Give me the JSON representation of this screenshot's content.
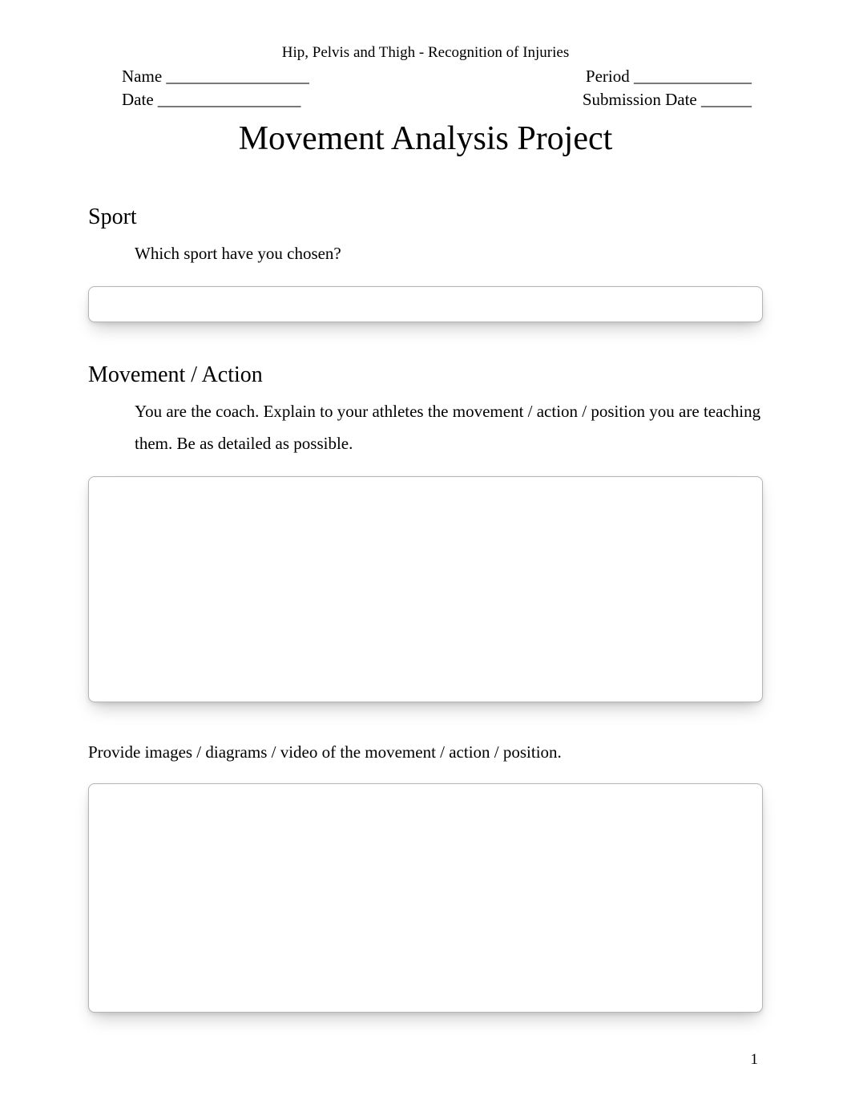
{
  "header": {
    "subject": "Hip, Pelvis and Thigh - Recognition of Injuries",
    "name_label": "Name  _________________",
    "period_label": "Period  ______________",
    "date_label": "Date    _________________",
    "submission_label": "Submission Date ______"
  },
  "title": "Movement Analysis Project",
  "sections": {
    "sport": {
      "heading": "Sport",
      "prompt": "Which sport have you chosen?"
    },
    "movement": {
      "heading": "Movement / Action",
      "prompt": "You are the coach. Explain to your athletes the movement / action / position you are teaching them. Be as detailed as possible."
    },
    "images_prompt": "Provide images / diagrams / video of the movement / action / position."
  },
  "page_number": "1"
}
